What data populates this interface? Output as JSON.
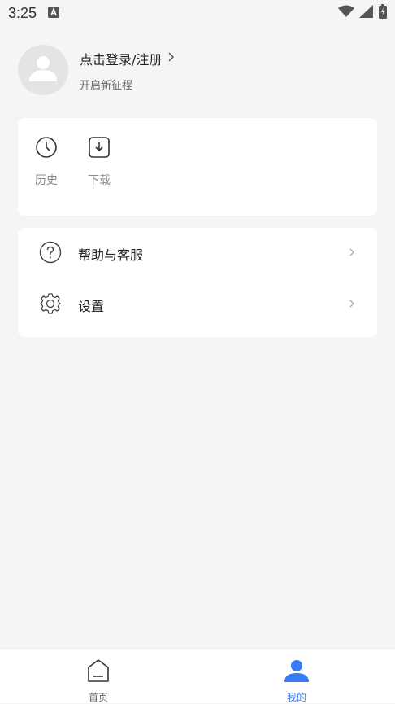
{
  "status_bar": {
    "time": "3:25"
  },
  "profile": {
    "login_label": "点击登录/注册",
    "subtitle": "开启新征程"
  },
  "quick_actions": [
    {
      "label": "历史",
      "icon": "clock-icon"
    },
    {
      "label": "下载",
      "icon": "download-icon"
    }
  ],
  "menu": [
    {
      "label": "帮助与客服",
      "icon": "help-icon"
    },
    {
      "label": "设置",
      "icon": "gear-icon"
    }
  ],
  "tabbar": {
    "tabs": [
      {
        "label": "首页",
        "icon": "home-icon",
        "active": false
      },
      {
        "label": "我的",
        "icon": "user-icon",
        "active": true
      }
    ]
  },
  "colors": {
    "accent": "#3a7bf6",
    "background": "#f4f5f7"
  }
}
